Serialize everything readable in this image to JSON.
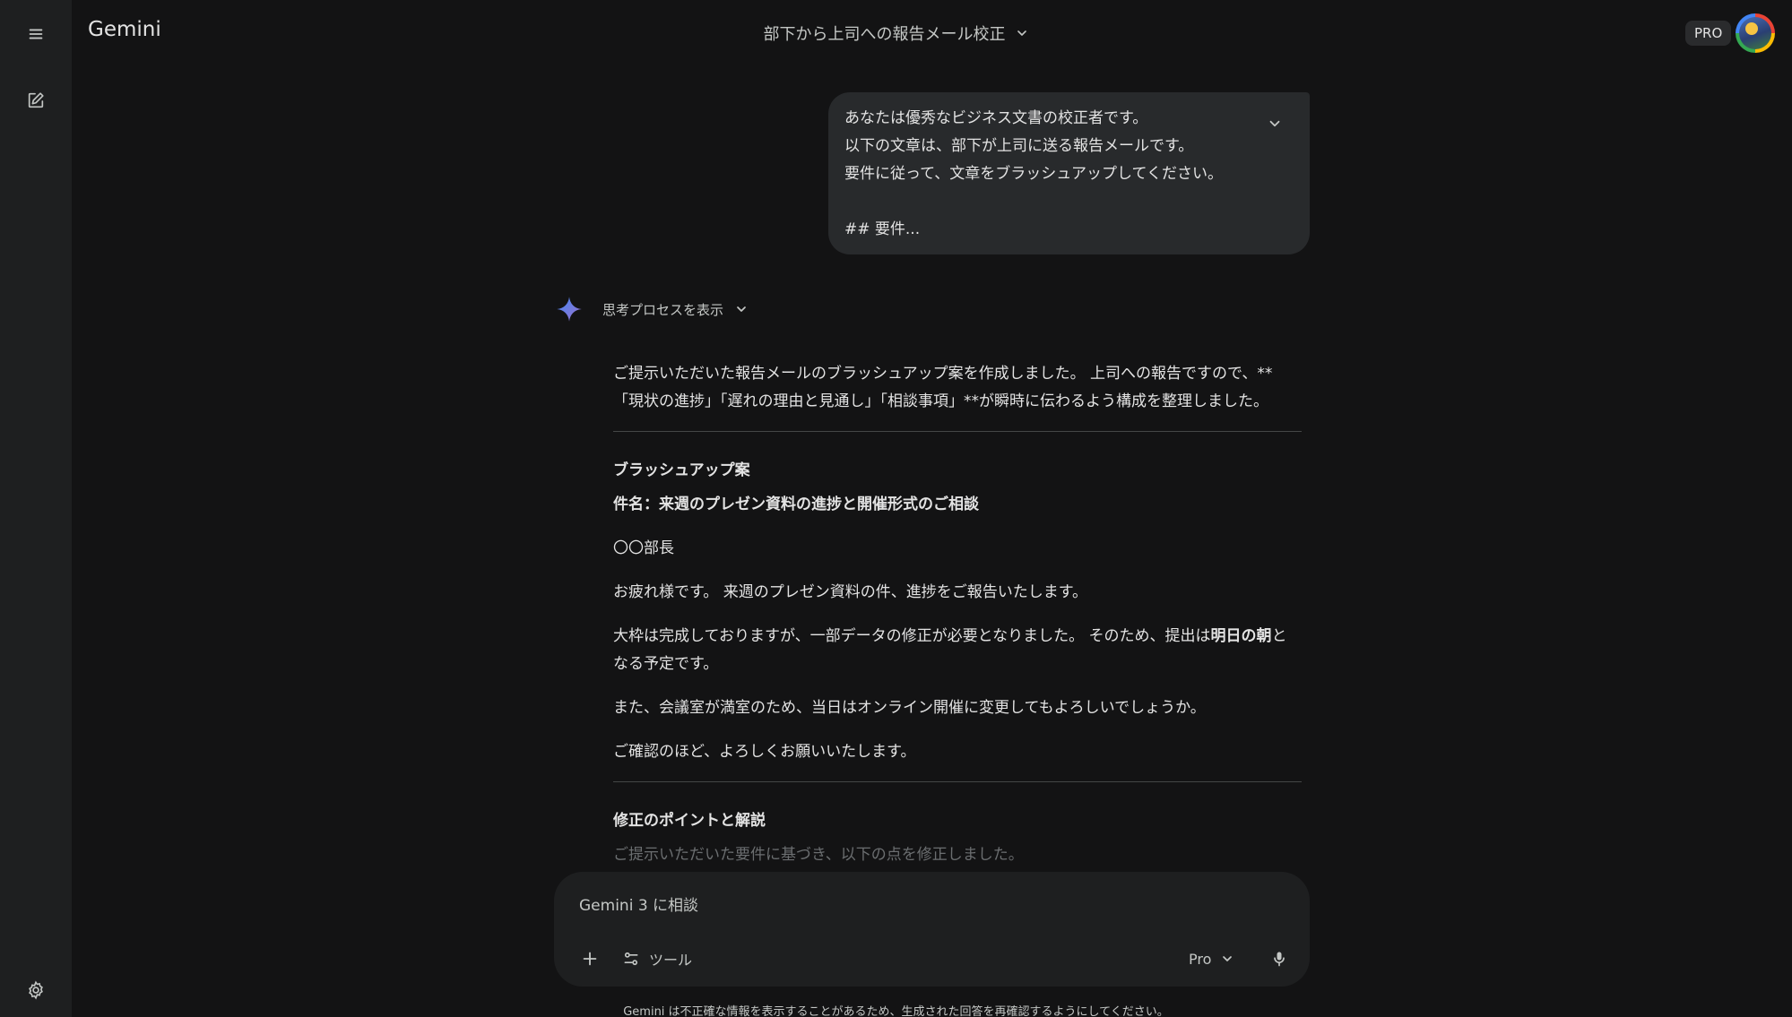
{
  "app": {
    "name": "Gemini",
    "conversation_title": "部下から上司への報告メール校正",
    "plan_badge": "PRO"
  },
  "sidebar": {
    "menu_icon": "menu-icon",
    "new_chat_icon": "edit-icon",
    "settings_icon": "settings-gear-icon"
  },
  "user_message": {
    "lines": [
      "あなたは優秀なビジネス文書の校正者です。",
      "以下の文章は、部下が上司に送る報告メールです。",
      "要件に従って、文章をブラッシュアップしてください。",
      "",
      "## 要件..."
    ]
  },
  "thinking": {
    "label": "思考プロセスを表示"
  },
  "response": {
    "intro_1": "ご提示いただいた報告メールのブラッシュアップ案を作成しました。 上司への報告ですので、**",
    "intro_2": "「現状の進捗」「遅れの理由と見通し」「相談事項」**が瞬時に伝わるよう構成を整理しました。",
    "section_title": "ブラッシュアップ案",
    "subject": "件名：来週のプレゼン資料の進捗と開催形式のご相談",
    "salutation": "〇〇部長",
    "p1": "お疲れ様です。 来週のプレゼン資料の件、進捗をご報告いたします。",
    "p2_before": "大枠は完成しておりますが、一部データの修正が必要となりました。 そのため、提出は",
    "p2_bold": "明日の朝",
    "p2_after": "となる予定です。",
    "p3": "また、会議室が満室のため、当日はオンライン開催に変更してもよろしいでしょうか。",
    "p4": "ご確認のほど、よろしくお願いいたします。",
    "section2_title": "修正のポイントと解説",
    "section2_first": "ご提示いただいた要件に基づき、以下の点を修正しました。"
  },
  "input": {
    "placeholder": "Gemini 3 に相談",
    "tools_label": "ツール",
    "model_label": "Pro"
  },
  "footer": {
    "disclaimer": "Gemini は不正確な情報を表示することがあるため、生成された回答を再確認するようにしてください。"
  },
  "colors": {
    "background": "#131314",
    "sidebar": "#1e1f20",
    "bubble": "#282a2c",
    "spark_from": "#4285f4",
    "spark_to": "#9b72cb"
  }
}
